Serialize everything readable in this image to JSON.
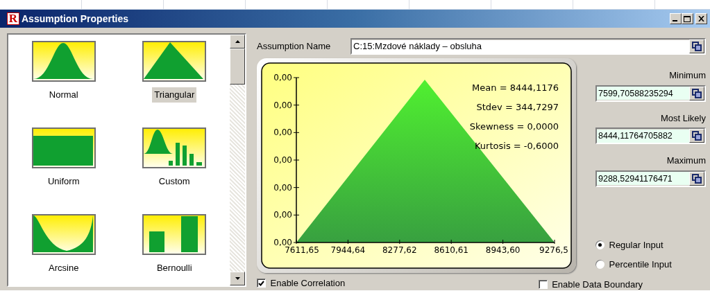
{
  "window": {
    "logo_text": "R",
    "title": "Assumption Properties"
  },
  "gallery": {
    "items": [
      {
        "label": "Normal",
        "kind": "normal",
        "selected": false
      },
      {
        "label": "Triangular",
        "kind": "triangular",
        "selected": true
      },
      {
        "label": "Uniform",
        "kind": "uniform",
        "selected": false
      },
      {
        "label": "Custom",
        "kind": "custom",
        "selected": false
      },
      {
        "label": "Arcsine",
        "kind": "arcsine",
        "selected": false
      },
      {
        "label": "Bernoulli",
        "kind": "bernoulli",
        "selected": false
      }
    ]
  },
  "assumption_name": {
    "label": "Assumption Name",
    "value": "C:15:Mzdové náklady – obsluha"
  },
  "chart": {
    "y_tick_labels": [
      "0,00",
      "0,00",
      "0,00",
      "0,00",
      "0,00",
      "0,00",
      "0,00"
    ],
    "x_tick_labels": [
      "7611,65",
      "7944,64",
      "8277,62",
      "8610,61",
      "8943,60",
      "9276,5"
    ],
    "stats": [
      "Mean = 8444,1176",
      "Stdev = 344,7297",
      "Skewness = 0,0000",
      "Kurtosis = -0,6000"
    ]
  },
  "parameters": [
    {
      "label": "Minimum",
      "value": "7599,70588235294"
    },
    {
      "label": "Most Likely",
      "value": "8444,11764705882"
    },
    {
      "label": "Maximum",
      "value": "9288,52941176471"
    }
  ],
  "input_mode": [
    {
      "label": "Regular Input",
      "selected": true
    },
    {
      "label": "Percentile Input",
      "selected": false
    }
  ],
  "options": [
    {
      "label": "Enable Correlation",
      "checked": true
    },
    {
      "label": "Enable Data Boundary",
      "checked": false
    }
  ]
}
